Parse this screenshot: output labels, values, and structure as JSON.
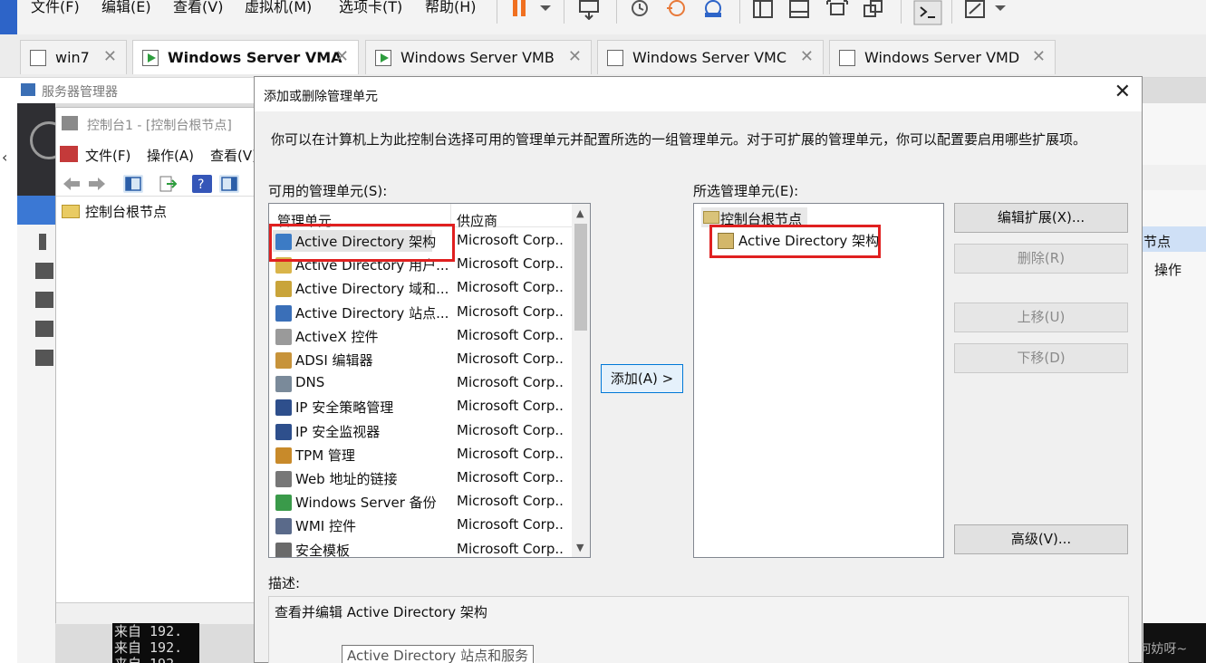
{
  "vmware": {
    "menus": [
      "文件(F)",
      "编辑(E)",
      "查看(V)",
      "虚拟机(M)",
      "选项卡(T)",
      "帮助(H)"
    ],
    "tabs": [
      {
        "label": "win7",
        "active": false
      },
      {
        "label": "Windows Server VMA",
        "active": true
      },
      {
        "label": "Windows Server VMB",
        "active": false
      },
      {
        "label": "Windows Server VMC",
        "active": false
      },
      {
        "label": "Windows Server VMD",
        "active": false
      }
    ],
    "close_glyph": "✕"
  },
  "server_manager": {
    "title": "服务器管理器"
  },
  "console": {
    "title": "控制台1 - [控制台根节点]",
    "menus": [
      "文件(F)",
      "操作(A)",
      "查看(V)"
    ],
    "tree_root": "控制台根节点"
  },
  "terminal": {
    "lines": [
      "来自 192.",
      "来自 192.",
      "来自 192."
    ]
  },
  "right_window": {
    "item1": "节点",
    "item2": "操作"
  },
  "watermark": "CSDN @何妨呀~",
  "dialog": {
    "title": "添加或删除管理单元",
    "close": "✕",
    "intro": "你可以在计算机上为此控制台选择可用的管理单元并配置所选的一组管理单元。对于可扩展的管理单元，你可以配置要启用哪些扩展项。",
    "available_label": "可用的管理单元(S):",
    "columns": {
      "name": "管理单元",
      "vendor": "供应商"
    },
    "snapins": [
      {
        "name": "Active Directory 架构",
        "vendor": "Microsoft Corp...",
        "icon_color": "#3c7bc5"
      },
      {
        "name": "Active Directory 用户...",
        "vendor": "Microsoft Corp...",
        "icon_color": "#d9b44a"
      },
      {
        "name": "Active Directory 域和...",
        "vendor": "Microsoft Corp...",
        "icon_color": "#c9a43a"
      },
      {
        "name": "Active Directory 站点...",
        "vendor": "Microsoft Corp...",
        "icon_color": "#3a6fb8"
      },
      {
        "name": "ActiveX 控件",
        "vendor": "Microsoft Corp...",
        "icon_color": "#9a9a9a"
      },
      {
        "name": "ADSI 编辑器",
        "vendor": "Microsoft Corp...",
        "icon_color": "#c7933a"
      },
      {
        "name": "DNS",
        "vendor": "Microsoft Corp...",
        "icon_color": "#7a8a9a"
      },
      {
        "name": "IP 安全策略管理",
        "vendor": "Microsoft Corp...",
        "icon_color": "#2e4f8c"
      },
      {
        "name": "IP 安全监视器",
        "vendor": "Microsoft Corp...",
        "icon_color": "#2e4f8c"
      },
      {
        "name": "TPM 管理",
        "vendor": "Microsoft Corp...",
        "icon_color": "#c88a2a"
      },
      {
        "name": "Web 地址的链接",
        "vendor": "Microsoft Corp...",
        "icon_color": "#777777"
      },
      {
        "name": "Windows Server 备份",
        "vendor": "Microsoft Corp...",
        "icon_color": "#3a9a4a"
      },
      {
        "name": "WMI 控件",
        "vendor": "Microsoft Corp...",
        "icon_color": "#5a6a8a"
      },
      {
        "name": "安全模板",
        "vendor": "Microsoft Corp...",
        "icon_color": "#6a6a6a"
      }
    ],
    "add_button": "添加(A) >",
    "selected_label": "所选管理单元(E):",
    "selected_root": "控制台根节点",
    "selected_child": "Active Directory 架构",
    "buttons": {
      "edit_ext": "编辑扩展(X)...",
      "remove": "删除(R)",
      "move_up": "上移(U)",
      "move_down": "下移(D)",
      "advanced": "高级(V)..."
    },
    "description_label": "描述:",
    "description": "查看并编辑 Active Directory 架构",
    "tooltip": "Active Directory 站点和服务"
  },
  "colors": {
    "highlight_box": "#e02020",
    "vmware_accent": "#2d64c8",
    "pause_icon": "#f07020",
    "focus_border": "#0078d7"
  }
}
